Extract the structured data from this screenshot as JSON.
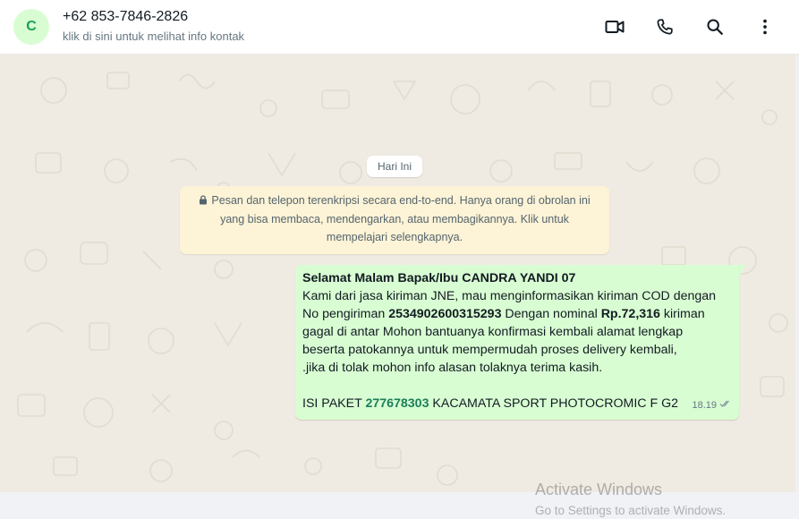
{
  "header": {
    "avatar_letter": "C",
    "contact_name": "+62 853-7846-2826",
    "contact_subtitle": "klik di sini untuk melihat info kontak",
    "icons": [
      "video-call-icon",
      "voice-call-icon",
      "search-icon",
      "more-options-icon"
    ]
  },
  "chat": {
    "date_chip": "Hari Ini",
    "encryption_notice": {
      "line1": "Pesan dan telepon terenkripsi secara end-to-end. Hanya orang di obrolan ini",
      "line2": "yang bisa membaca, mendengarkan, atau membagikannya. Klik untuk",
      "line3": "mempelajari selengkapnya."
    },
    "message": {
      "greeting": "Selamat Malam Bapak/Ibu CANDRA YANDI 07",
      "line1": "Kami dari jasa kiriman JNE, mau menginformasikan kiriman COD dengan",
      "line2_prefix": "No pengiriman ",
      "tracking_number": "2534902600315293",
      "line2_middle": " Dengan nominal ",
      "amount": "Rp.72,316",
      "line2_suffix": " kiriman",
      "line3": "gagal di antar Mohon bantuanya konfirmasi kembali alamat lengkap",
      "line4": "beserta patokannya untuk mempermudah proses delivery kembali,",
      "line5": " .jika di tolak mohon info alasan tolaknya terima kasih.",
      "package_prefix": "ISI PAKET ",
      "package_number": "277678303",
      "package_suffix": " KACAMATA SPORT PHOTOCROMIC F G2",
      "time": "18.19",
      "status_icon": "double-check-icon"
    }
  },
  "watermark": {
    "title": "Activate Windows",
    "subtitle": "Go to Settings to activate Windows."
  },
  "colors": {
    "bubble_out": "#d9fdd3",
    "notice_bg": "#fdf3d6",
    "chat_bg": "#efeae2",
    "link_green": "#1b7f5a"
  }
}
